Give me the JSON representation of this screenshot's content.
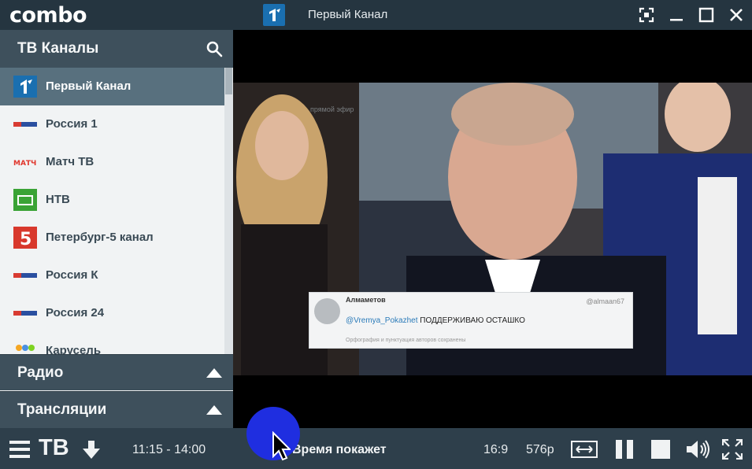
{
  "app": {
    "logo": "combo",
    "window_title": "Первый Канал"
  },
  "sidebar": {
    "header_label": "ТВ Каналы",
    "channels": [
      {
        "label": "Первый Канал",
        "icon": "channel-one-logo-icon"
      },
      {
        "label": "Россия 1",
        "icon": "russia-1-logo-icon"
      },
      {
        "label": "Матч ТВ",
        "icon": "match-tv-logo-icon"
      },
      {
        "label": "НТВ",
        "icon": "ntv-logo-icon"
      },
      {
        "label": "Петербург-5 канал",
        "icon": "channel-5-logo-icon"
      },
      {
        "label": "Россия К",
        "icon": "russia-k-logo-icon"
      },
      {
        "label": "Россия 24",
        "icon": "russia-24-logo-icon"
      },
      {
        "label": "Карусель",
        "icon": "karusel-logo-icon"
      }
    ],
    "active_index": 0,
    "sections": [
      {
        "label": "Радио"
      },
      {
        "label": "Трансляции"
      }
    ]
  },
  "video": {
    "overlay_watermark": "прямой эфир",
    "tweet": {
      "name": "Алмаметов",
      "handle": "@almaan67",
      "mention": "@Vremya_Pokazhet",
      "text": " ПОДДЕРЖИВАЮ  ОСТАШКО",
      "footer": "Орфография и пунктуация авторов сохранены"
    }
  },
  "bottombar": {
    "tv_label": "ТВ",
    "time_range": "11:15 - 14:00",
    "program_title": "Время покажет",
    "aspect_ratio": "16:9",
    "quality": "576p"
  },
  "colors": {
    "titlebar": "#253540",
    "sidebar_header": "#3e505c",
    "active_item": "#58707e",
    "bottombar": "#2e3f4b",
    "cursor_highlight": "#1f2ee0"
  }
}
